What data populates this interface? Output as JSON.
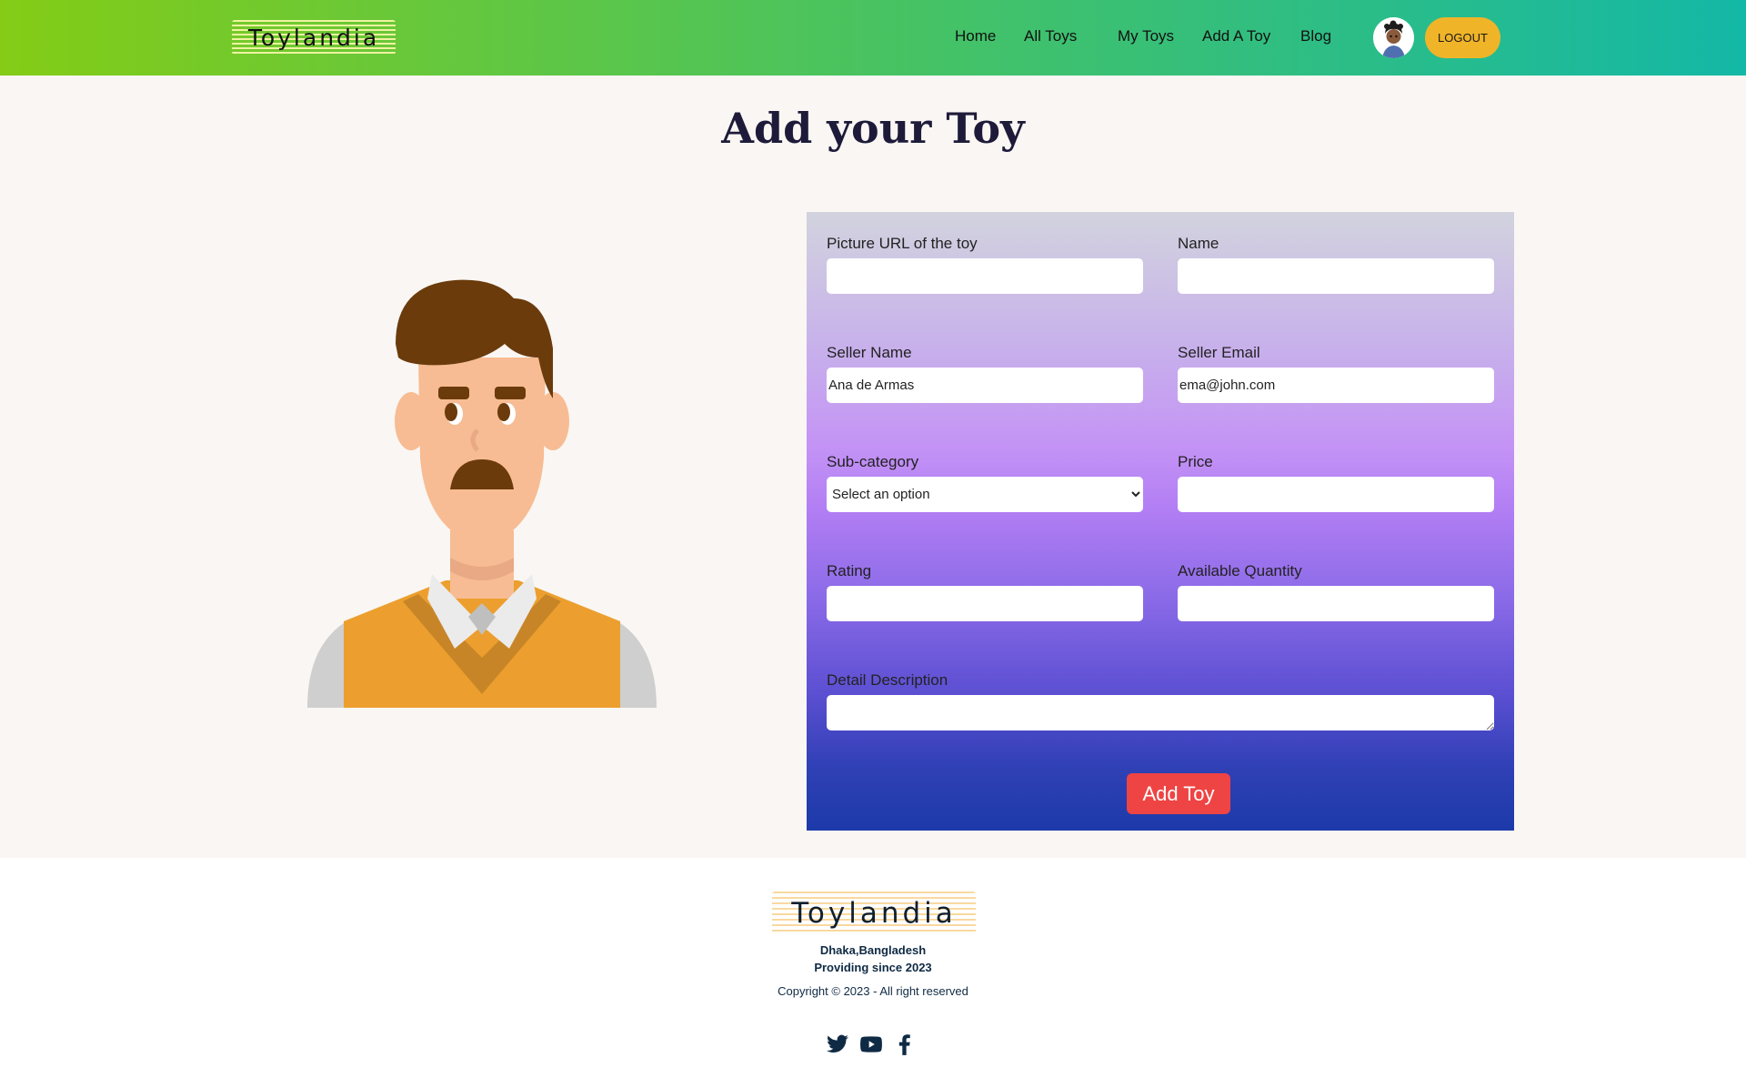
{
  "brand": {
    "logo_text": "Toylandia"
  },
  "nav": {
    "links": [
      "Home",
      "All Toys",
      "My Toys",
      "Add A Toy",
      "Blog"
    ],
    "logout_label": "LOGOUT"
  },
  "page": {
    "title": "Add your Toy"
  },
  "form": {
    "picture_url": {
      "label": "Picture URL of the toy",
      "value": ""
    },
    "name": {
      "label": "Name",
      "value": ""
    },
    "seller_name": {
      "label": "Seller Name",
      "value": "Ana de Armas"
    },
    "seller_email": {
      "label": "Seller Email",
      "value": "ema@john.com"
    },
    "subcategory": {
      "label": "Sub-category",
      "selected": "Select an option"
    },
    "price": {
      "label": "Price",
      "value": ""
    },
    "rating": {
      "label": "Rating",
      "value": ""
    },
    "quantity": {
      "label": "Available Quantity",
      "value": ""
    },
    "description": {
      "label": "Detail Description",
      "value": ""
    },
    "submit_label": "Add Toy"
  },
  "footer": {
    "logo_text": "Toylandia",
    "location": "Dhaka,Bangladesh",
    "since": "Providing since 2023",
    "copyright": "Copyright © 2023 - All right reserved",
    "socials": [
      "twitter-icon",
      "youtube-icon",
      "facebook-icon"
    ]
  },
  "colors": {
    "nav_gradient_start": "#84cc16",
    "nav_gradient_end": "#14b8a6",
    "logout_bg": "#f0b429",
    "submit_bg": "#ef4444",
    "panel_top": "#d2d3de",
    "panel_mid": "#c493f5",
    "panel_bottom": "#1d3aa9"
  }
}
